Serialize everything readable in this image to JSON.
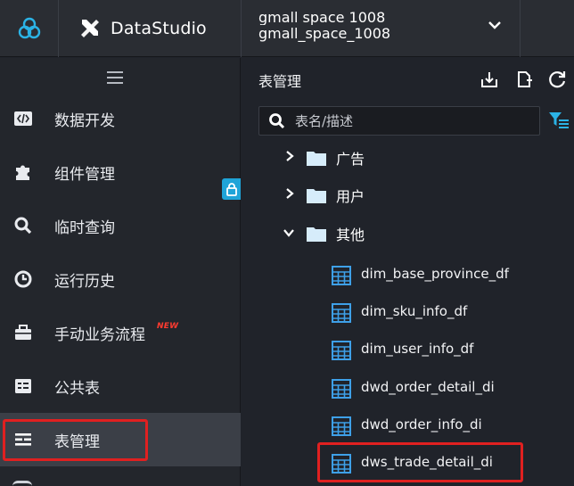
{
  "topbar": {
    "brand": "DataStudio",
    "workspace_line1": "gmall space 1008",
    "workspace_line2": "gmall_space_1008"
  },
  "sidebar": {
    "items": [
      {
        "label": "数据开发",
        "icon": "code-icon"
      },
      {
        "label": "组件管理",
        "icon": "puzzle-icon"
      },
      {
        "label": "临时查询",
        "icon": "search-icon"
      },
      {
        "label": "运行历史",
        "icon": "clock-icon"
      },
      {
        "label": "手动业务流程",
        "icon": "briefcase-icon",
        "badge": "NEW"
      },
      {
        "label": "公共表",
        "icon": "table-list-icon"
      },
      {
        "label": "表管理",
        "icon": "table-manage-icon",
        "active": true
      }
    ]
  },
  "panel": {
    "title": "表管理",
    "search_placeholder": "表名/描述",
    "folders": [
      {
        "label": "广告",
        "expanded": false
      },
      {
        "label": "用户",
        "expanded": false
      },
      {
        "label": "其他",
        "expanded": true
      }
    ],
    "tables": [
      "dim_base_province_df",
      "dim_sku_info_df",
      "dim_user_info_df",
      "dwd_order_detail_di",
      "dwd_order_info_di",
      "dws_trade_detail_di"
    ]
  },
  "colors": {
    "highlight": "#e02020",
    "accent": "#1fa4d8",
    "table_icon": "#3ea0e8",
    "folder_icon": "#cfe8f7"
  }
}
